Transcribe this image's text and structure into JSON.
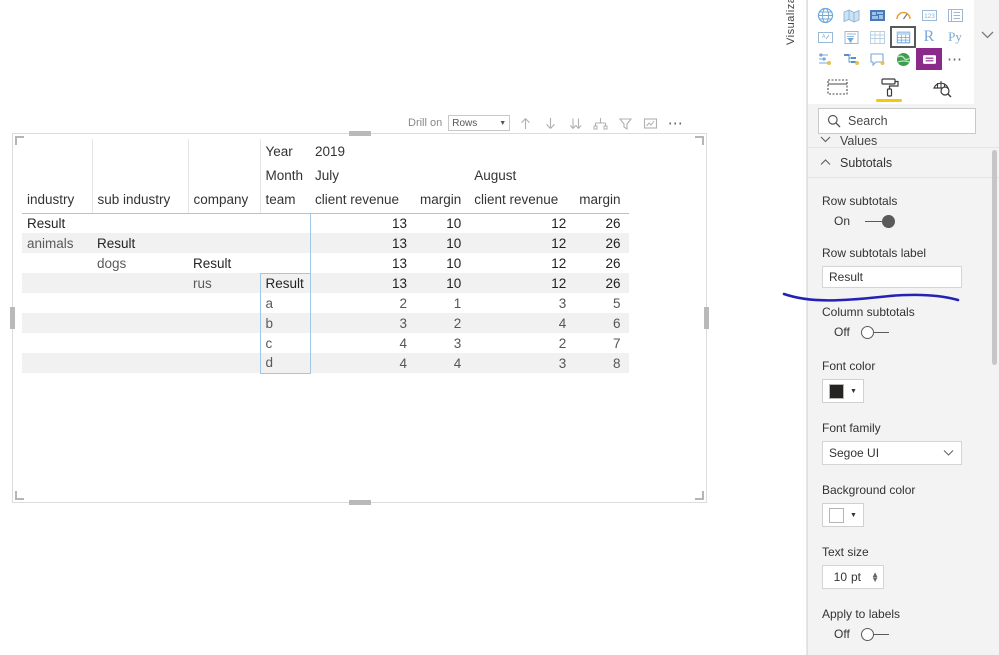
{
  "canvas": {
    "drill_toolbar": {
      "label": "Drill on",
      "dropdown_value": "Rows",
      "icons": [
        {
          "name": "drill-up-icon",
          "glyph": "up-arrow"
        },
        {
          "name": "drill-down-icon",
          "glyph": "down-arrow"
        },
        {
          "name": "expand-all-icon",
          "glyph": "double-down-arrow"
        },
        {
          "name": "expand-next-level-icon",
          "glyph": "fork-down"
        },
        {
          "name": "filter-icon",
          "glyph": "funnel"
        },
        {
          "name": "focus-mode-icon",
          "glyph": "focus"
        },
        {
          "name": "more-options-icon",
          "glyph": "ellipsis"
        }
      ]
    },
    "matrix": {
      "row_headers": [
        "industry",
        "sub industry",
        "company",
        "team"
      ],
      "column_hierarchy": [
        {
          "level": "Year",
          "value": "2019"
        },
        {
          "level": "Month",
          "values": [
            "July",
            "August"
          ]
        }
      ],
      "measure_headers": [
        "client revenue",
        "margin",
        "client revenue",
        "margin"
      ],
      "rows": [
        {
          "industry": "Result",
          "sub_industry": "",
          "company": "",
          "team": "",
          "values": [
            "13",
            "10",
            "12",
            "26"
          ],
          "bold": true,
          "alt": false
        },
        {
          "industry": "animals",
          "sub_industry": "Result",
          "company": "",
          "team": "",
          "values": [
            "13",
            "10",
            "12",
            "26"
          ],
          "bold": true,
          "alt": true
        },
        {
          "industry": "",
          "sub_industry": "dogs",
          "company": "Result",
          "team": "",
          "values": [
            "13",
            "10",
            "12",
            "26"
          ],
          "bold": true,
          "alt": false
        },
        {
          "industry": "",
          "sub_industry": "",
          "company": "rus",
          "team": "Result",
          "values": [
            "13",
            "10",
            "12",
            "26"
          ],
          "bold": true,
          "alt": true
        },
        {
          "industry": "",
          "sub_industry": "",
          "company": "",
          "team": "a",
          "values": [
            "2",
            "1",
            "3",
            "5"
          ],
          "bold": false,
          "alt": false
        },
        {
          "industry": "",
          "sub_industry": "",
          "company": "",
          "team": "b",
          "values": [
            "3",
            "2",
            "4",
            "6"
          ],
          "bold": false,
          "alt": true
        },
        {
          "industry": "",
          "sub_industry": "",
          "company": "",
          "team": "c",
          "values": [
            "4",
            "3",
            "2",
            "7"
          ],
          "bold": false,
          "alt": false
        },
        {
          "industry": "",
          "sub_industry": "",
          "company": "",
          "team": "d",
          "values": [
            "4",
            "4",
            "3",
            "8"
          ],
          "bold": false,
          "alt": true
        }
      ]
    }
  },
  "rail": {
    "label": "Visualizations"
  },
  "panel": {
    "gallery": {
      "rows": [
        [
          "globe-map-icon",
          "filled-map-icon",
          "shape-map-icon",
          "gauge-icon",
          "card-icon",
          "multi-row-card-icon"
        ],
        [
          "kpi-icon",
          "slicer-icon",
          "table-icon",
          "matrix-icon",
          "r-script-icon",
          "python-script-icon"
        ],
        [
          "key-influencers-icon",
          "decomposition-tree-icon",
          "q-and-a-icon",
          "arcgis-map-icon",
          "paginated-report-icon",
          "more-visuals-icon"
        ]
      ],
      "selected": "matrix-icon",
      "collapse_icon": "chevron-down-icon"
    },
    "tabs": [
      {
        "name": "fields-tab",
        "icon": "fields-grid-icon",
        "selected": false
      },
      {
        "name": "format-tab",
        "icon": "paint-roller-icon",
        "selected": true
      },
      {
        "name": "analytics-tab",
        "icon": "magnifier-analytics-icon",
        "selected": false
      }
    ],
    "search": {
      "placeholder": "Search",
      "icon": "search-icon"
    },
    "sections": [
      {
        "name": "values-section",
        "title": "Values",
        "expanded": false,
        "chevron": "chevron-down-icon",
        "clipped": true
      },
      {
        "name": "subtotals-section",
        "title": "Subtotals",
        "expanded": true,
        "chevron": "chevron-up-icon",
        "properties": [
          {
            "name": "row-subtotals",
            "label": "Row subtotals",
            "type": "toggle",
            "state": "On"
          },
          {
            "name": "row-subtotals-label",
            "label": "Row subtotals label",
            "type": "text",
            "value": "Result"
          },
          {
            "name": "column-subtotals",
            "label": "Column subtotals",
            "type": "toggle",
            "state": "Off"
          },
          {
            "name": "font-color",
            "label": "Font color",
            "type": "color",
            "value": "#252423"
          },
          {
            "name": "font-family",
            "label": "Font family",
            "type": "select",
            "value": "Segoe UI"
          },
          {
            "name": "background-color",
            "label": "Background color",
            "type": "color",
            "value": "#ffffff"
          },
          {
            "name": "text-size",
            "label": "Text size",
            "type": "spinner",
            "value": "10",
            "unit": "pt"
          },
          {
            "name": "apply-to-labels",
            "label": "Apply to labels",
            "type": "toggle",
            "state": "Off"
          }
        ]
      }
    ]
  },
  "annotation": {
    "name": "blue-pen-underline",
    "color": "#2222b4",
    "target": "row-subtotals-label"
  },
  "colors": {
    "accent_blue": "#9ec7e8",
    "alt_row": "#f1f1f1",
    "panel_bg": "#f3f3f3",
    "tab_underline": "#f2c811"
  }
}
